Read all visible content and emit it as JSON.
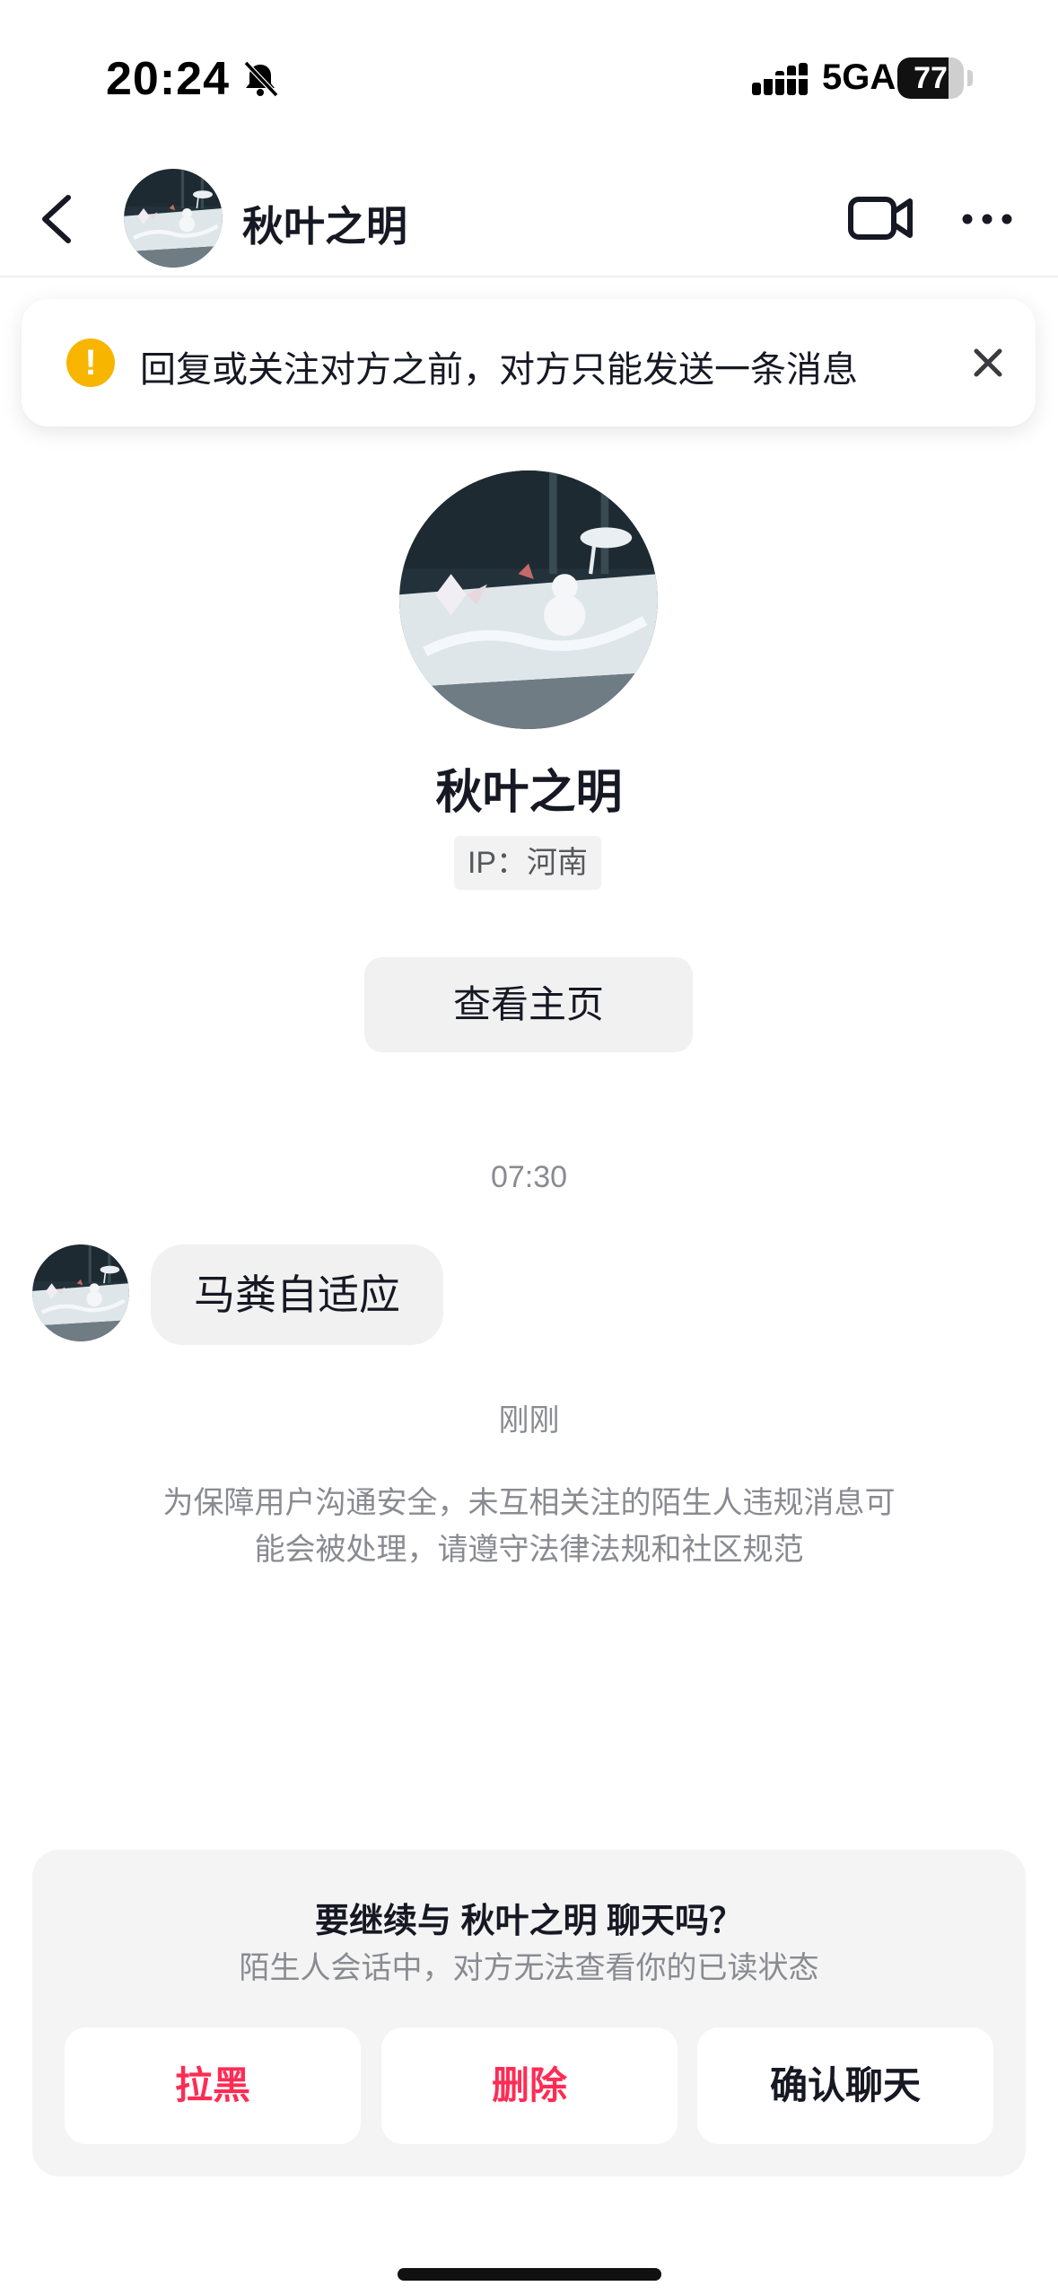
{
  "status_bar": {
    "time": "20:24",
    "network": "5GA",
    "battery": "77",
    "battery_level": 0.77
  },
  "header": {
    "name": "秋叶之明"
  },
  "notice": {
    "text": "回复或关注对方之前，对方只能发送一条消息",
    "icon": "!"
  },
  "profile": {
    "name": "秋叶之明",
    "ip": "IP：河南",
    "view_button": "查看主页"
  },
  "messages": [
    {
      "time": "07:30",
      "text": "马粪自适应"
    }
  ],
  "system": {
    "time": "刚刚",
    "hint_line1": "为保障用户沟通安全，未互相关注的陌生人违规消息可",
    "hint_line2": "能会被处理，请遵守法律法规和社区规范"
  },
  "panel": {
    "title": "要继续与 秋叶之明 聊天吗？",
    "subtitle": "陌生人会话中，对方无法查看你的已读状态",
    "buttons": [
      "拉黑",
      "删除",
      "确认聊天"
    ]
  },
  "colors": {
    "accent": "#fe2c55",
    "warning": "#f7b500"
  }
}
